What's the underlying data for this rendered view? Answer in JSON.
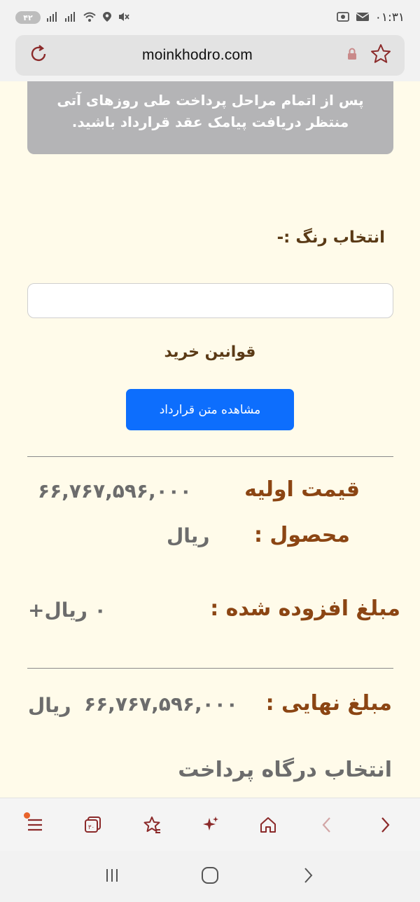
{
  "status_bar": {
    "time": "۰۱:۳۱",
    "battery": "۴۲",
    "icons": [
      "battery-icon",
      "signal-icon",
      "signal-icon",
      "wifi-icon",
      "location-icon",
      "mute-icon",
      "screenshot-icon",
      "mail-icon"
    ]
  },
  "browser": {
    "url": "moinkhodro.com",
    "icons": [
      "reload-icon",
      "lock-icon",
      "bookmark-star-icon"
    ]
  },
  "page": {
    "notice_line1": "پس از اتمام مراحل پرداخت طی روزهای آتی",
    "notice_line2": "منتظر دریافت پیامک عقد قرارداد باشید.",
    "color_label": "انتخاب رنگ :-",
    "color_input_value": "",
    "terms_title": "قوانین خرید",
    "contract_button": "مشاهده متن قرارداد",
    "initial_price_label_line1": "قیمت اولیه",
    "initial_price_label_line2": "محصول :",
    "initial_price_value": "۶۶,۷۶۷,۵۹۶,۰۰۰",
    "initial_price_unit": "ریال",
    "added_amount_label": "مبلغ افزوده شده :",
    "added_amount_value": "۰ ریال+",
    "final_amount_label": "مبلغ نهایی :",
    "final_amount_value": "۶۶,۷۶۷,۵۹۶,۰۰۰",
    "final_amount_unit": "ریال",
    "gateway_title": "انتخاب درگاه پرداخت"
  },
  "toolbar": {
    "tabs_count": "۳۰",
    "items": [
      "menu-icon",
      "tabs-icon",
      "bookmarks-icon",
      "ai-sparkle-icon",
      "home-icon",
      "back-icon",
      "forward-icon"
    ]
  },
  "colors": {
    "accent_blue": "#0d6efd",
    "brown_text": "#8b4513",
    "dark_brown_text": "#5a3a16",
    "page_bg": "#fffbea",
    "notice_bg": "#b4b4b6",
    "toolbar_icon": "#8b2a2a"
  }
}
